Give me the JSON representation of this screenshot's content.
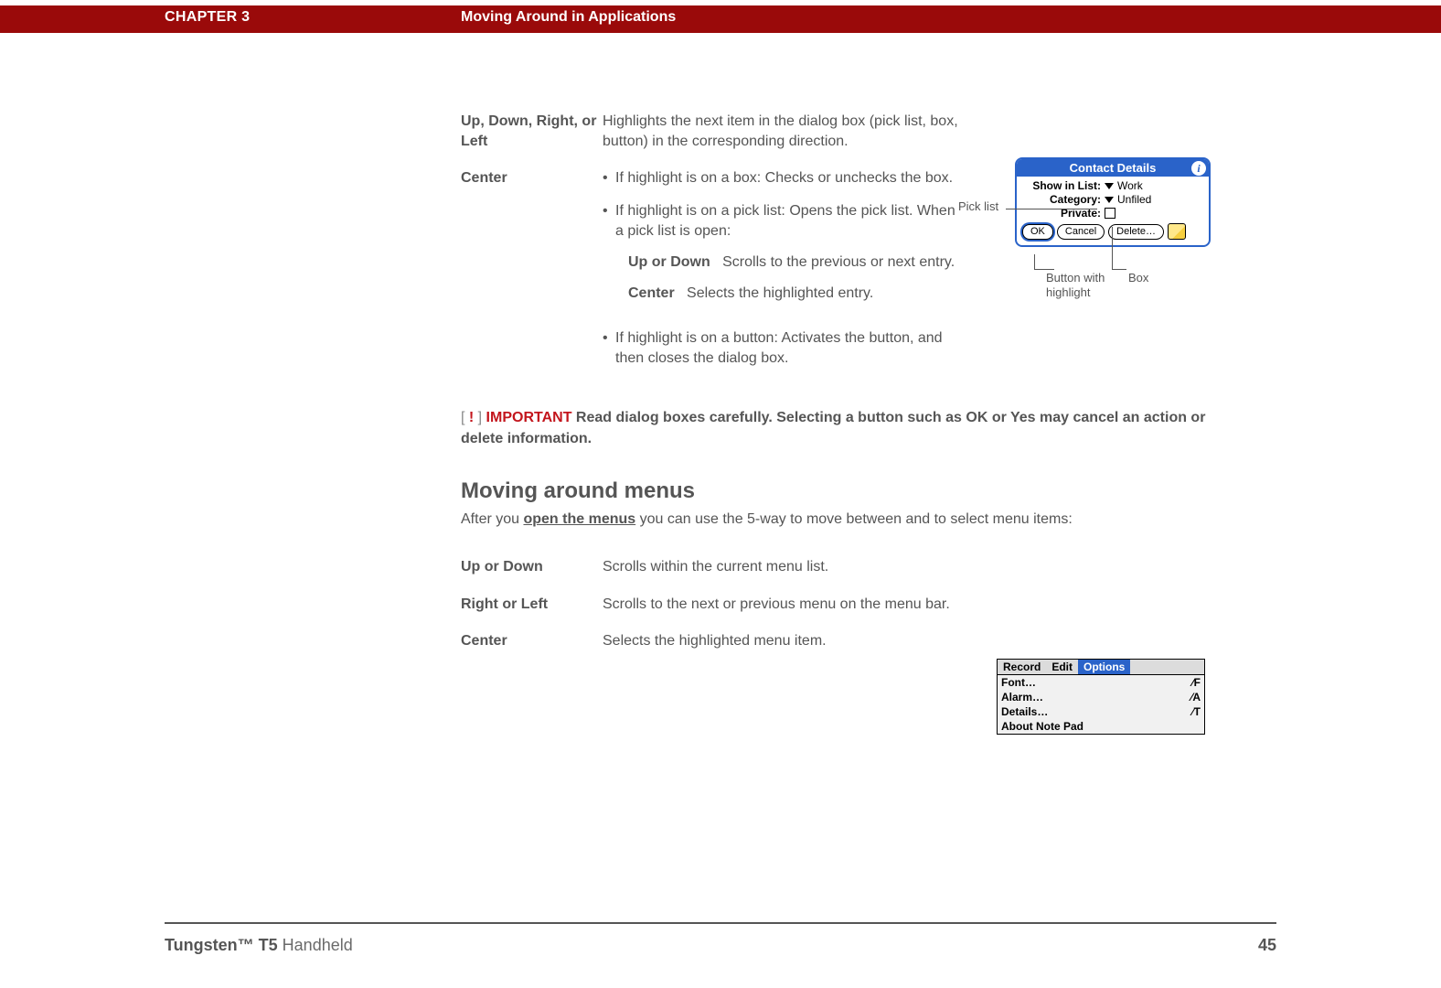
{
  "header": {
    "chapter": "CHAPTER 3",
    "title": "Moving Around in Applications"
  },
  "def1": {
    "term": "Up, Down, Right, or Left",
    "desc": "Highlights the next item in the dialog box (pick list, box, button) in the corresponding direction."
  },
  "def2": {
    "term": "Center",
    "b1": "If highlight is on a box: Checks or unchecks the box.",
    "b2": "If highlight is on a pick list: Opens the pick list. When a pick list is open:",
    "b2a_k": "Up or Down",
    "b2a_v": "Scrolls to the previous or next entry.",
    "b2b_k": "Center",
    "b2b_v": "Selects the highlighted entry.",
    "b3": "If highlight is on a button: Activates the button, and then closes the dialog box."
  },
  "important": {
    "brL": "[ ",
    "bang": "!",
    "brR": " ]",
    "label": " IMPORTANT",
    "text": "  Read dialog boxes carefully. Selecting a button such as OK or Yes may cancel an action or delete information."
  },
  "section2": {
    "heading": "Moving around menus",
    "intro_a": "After you ",
    "intro_link": "open the menus",
    "intro_b": " you can use the 5-way to move between and to select menu items:"
  },
  "menu": {
    "r1k": "Up or Down",
    "r1v": "Scrolls within the current menu list.",
    "r2k": "Right or Left",
    "r2v": "Scrolls to the next or previous menu on the menu bar.",
    "r3k": "Center",
    "r3v": "Selects the highlighted menu item."
  },
  "dlg": {
    "title": "Contact Details",
    "row1l": "Show in List:",
    "row1v": "Work",
    "row2l": "Category:",
    "row2v": "Unfiled",
    "row3l": "Private:",
    "ok": "OK",
    "cancel": "Cancel",
    "delete": "Delete…"
  },
  "callouts": {
    "picklist": "Pick list",
    "btnhl": "Button with highlight",
    "box": "Box"
  },
  "menubar": {
    "m1": "Record",
    "m2": "Edit",
    "m3": "Options",
    "i1": "Font…",
    "s1": "⁄F",
    "i2": "Alarm…",
    "s2": "⁄A",
    "i3": "Details…",
    "s3": "⁄T",
    "i4": "About Note Pad"
  },
  "footer": {
    "prod_b": "Tungsten™ T5",
    "prod_r": " Handheld",
    "page": "45"
  }
}
